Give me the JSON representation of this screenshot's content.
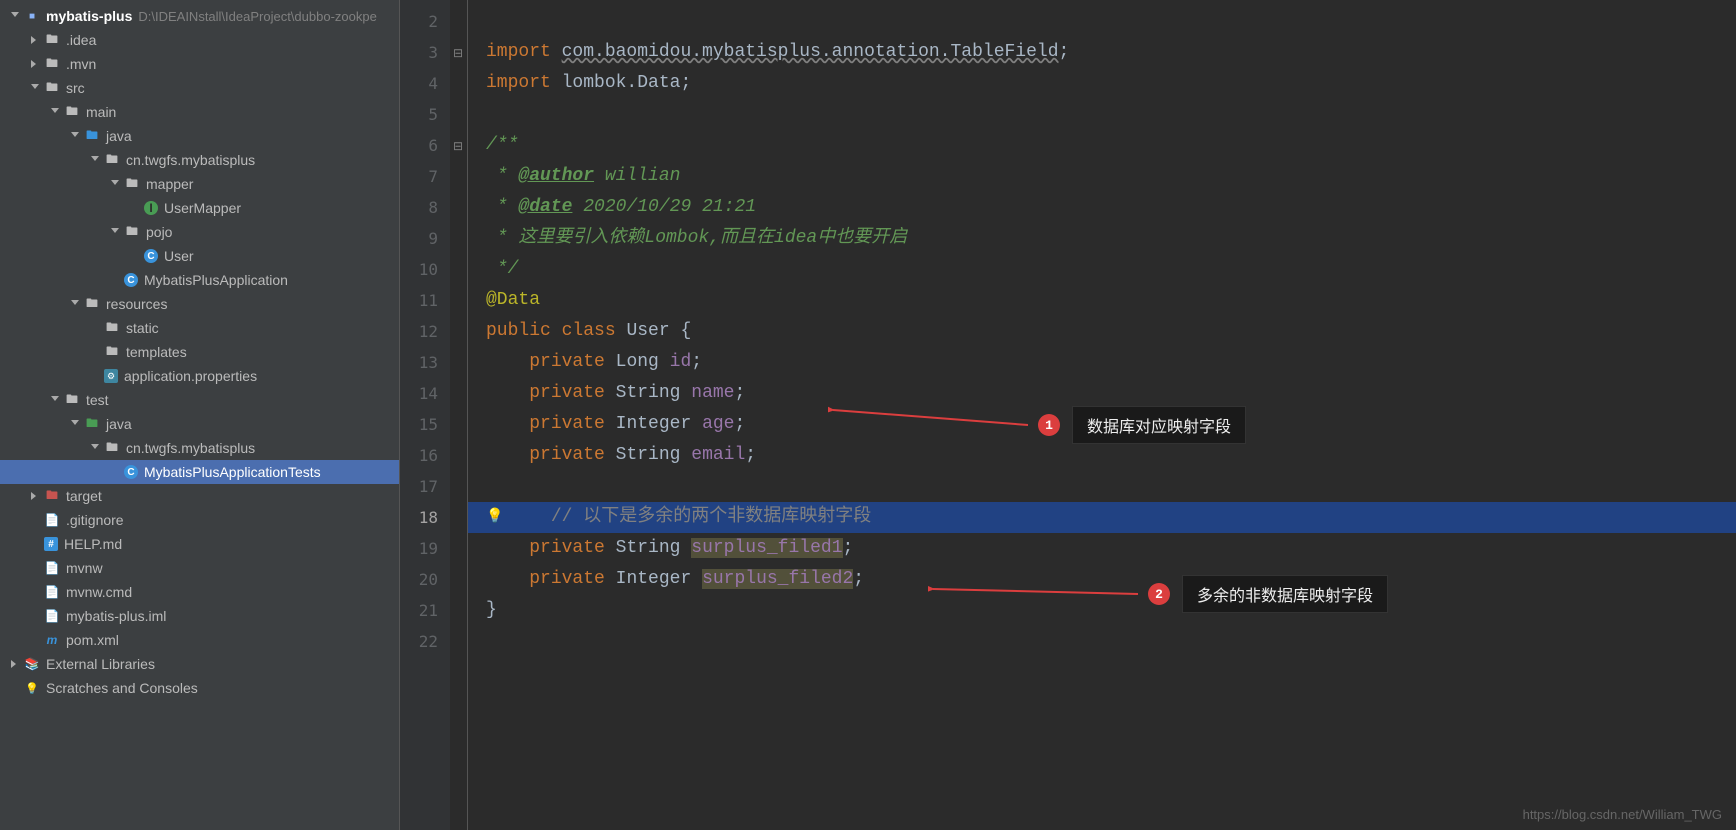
{
  "project": {
    "name": "mybatis-plus",
    "path": "D:\\IDEAINstall\\IdeaProject\\dubbo-zookpe"
  },
  "tree": [
    {
      "depth": 0,
      "chev": "expanded",
      "icon": "module",
      "label": "mybatis-plus",
      "isProject": true
    },
    {
      "depth": 1,
      "chev": "collapsed",
      "icon": "folder",
      "label": ".idea"
    },
    {
      "depth": 1,
      "chev": "collapsed",
      "icon": "folder",
      "label": ".mvn"
    },
    {
      "depth": 1,
      "chev": "expanded",
      "icon": "folder",
      "label": "src"
    },
    {
      "depth": 2,
      "chev": "expanded",
      "icon": "folder",
      "label": "main"
    },
    {
      "depth": 3,
      "chev": "expanded",
      "icon": "folder-src",
      "label": "java"
    },
    {
      "depth": 4,
      "chev": "expanded",
      "icon": "package",
      "label": "cn.twgfs.mybatisplus"
    },
    {
      "depth": 5,
      "chev": "expanded",
      "icon": "package",
      "label": "mapper"
    },
    {
      "depth": 6,
      "chev": "none",
      "icon": "java-int",
      "label": "UserMapper"
    },
    {
      "depth": 5,
      "chev": "expanded",
      "icon": "package",
      "label": "pojo"
    },
    {
      "depth": 6,
      "chev": "none",
      "icon": "java-cls",
      "label": "User"
    },
    {
      "depth": 5,
      "chev": "none",
      "icon": "java-cls",
      "label": "MybatisPlusApplication"
    },
    {
      "depth": 3,
      "chev": "expanded",
      "icon": "folder",
      "label": "resources"
    },
    {
      "depth": 4,
      "chev": "none",
      "icon": "folder",
      "label": "static"
    },
    {
      "depth": 4,
      "chev": "none",
      "icon": "folder",
      "label": "templates"
    },
    {
      "depth": 4,
      "chev": "none",
      "icon": "props",
      "label": "application.properties"
    },
    {
      "depth": 2,
      "chev": "expanded",
      "icon": "folder",
      "label": "test"
    },
    {
      "depth": 3,
      "chev": "expanded",
      "icon": "folder-test",
      "label": "java"
    },
    {
      "depth": 4,
      "chev": "expanded",
      "icon": "package",
      "label": "cn.twgfs.mybatisplus"
    },
    {
      "depth": 5,
      "chev": "none",
      "icon": "java-cls",
      "label": "MybatisPlusApplicationTests",
      "selected": true
    },
    {
      "depth": 1,
      "chev": "collapsed",
      "icon": "folder-target",
      "label": "target"
    },
    {
      "depth": 1,
      "chev": "none",
      "icon": "file",
      "label": ".gitignore"
    },
    {
      "depth": 1,
      "chev": "none",
      "icon": "md",
      "label": "HELP.md"
    },
    {
      "depth": 1,
      "chev": "none",
      "icon": "file",
      "label": "mvnw"
    },
    {
      "depth": 1,
      "chev": "none",
      "icon": "file",
      "label": "mvnw.cmd"
    },
    {
      "depth": 1,
      "chev": "none",
      "icon": "xml",
      "label": "mybatis-plus.iml"
    },
    {
      "depth": 1,
      "chev": "none",
      "icon": "maven",
      "label": "pom.xml"
    },
    {
      "depth": 0,
      "chev": "collapsed",
      "icon": "lib",
      "label": "External Libraries"
    },
    {
      "depth": 0,
      "chev": "none",
      "icon": "scratch",
      "label": "Scratches and Consoles"
    }
  ],
  "editor": {
    "startLine": 2,
    "currentLine": 18,
    "lines": [
      {
        "n": 2,
        "fold": "",
        "tokens": []
      },
      {
        "n": 3,
        "fold": "minus",
        "tokens": [
          {
            "t": "kw",
            "v": "import "
          },
          {
            "t": "import-pkg",
            "v": "com.baomidou.mybatisplus.annotation.TableField"
          },
          {
            "t": "",
            "v": ";"
          }
        ]
      },
      {
        "n": 4,
        "fold": "",
        "tokens": [
          {
            "t": "kw",
            "v": "import "
          },
          {
            "t": "",
            "v": "lombok."
          },
          {
            "t": "",
            "v": "Data"
          },
          {
            "t": "",
            "v": ";"
          }
        ]
      },
      {
        "n": 5,
        "fold": "",
        "tokens": []
      },
      {
        "n": 6,
        "fold": "minus",
        "tokens": [
          {
            "t": "cmt",
            "v": "/**"
          }
        ]
      },
      {
        "n": 7,
        "fold": "",
        "tokens": [
          {
            "t": "cmt",
            "v": " * "
          },
          {
            "t": "cmt-tag",
            "v": "@author"
          },
          {
            "t": "cmt",
            "v": " willian"
          }
        ]
      },
      {
        "n": 8,
        "fold": "",
        "tokens": [
          {
            "t": "cmt",
            "v": " * "
          },
          {
            "t": "cmt-tag",
            "v": "@date"
          },
          {
            "t": "cmt",
            "v": " 2020/10/29 21:21"
          }
        ]
      },
      {
        "n": 9,
        "fold": "",
        "tokens": [
          {
            "t": "cmt",
            "v": " * 这里要引入依赖Lombok,而且在idea中也要开启"
          }
        ]
      },
      {
        "n": 10,
        "fold": "",
        "tokens": [
          {
            "t": "cmt",
            "v": " */"
          }
        ]
      },
      {
        "n": 11,
        "fold": "",
        "tokens": [
          {
            "t": "anno",
            "v": "@Data"
          }
        ]
      },
      {
        "n": 12,
        "fold": "",
        "tokens": [
          {
            "t": "kw",
            "v": "public class "
          },
          {
            "t": "cls",
            "v": "User"
          },
          {
            "t": "",
            "v": " {"
          }
        ]
      },
      {
        "n": 13,
        "fold": "",
        "tokens": [
          {
            "t": "",
            "v": "    "
          },
          {
            "t": "kw",
            "v": "private "
          },
          {
            "t": "typ",
            "v": "Long "
          },
          {
            "t": "fld",
            "v": "id"
          },
          {
            "t": "",
            "v": ";"
          }
        ]
      },
      {
        "n": 14,
        "fold": "",
        "tokens": [
          {
            "t": "",
            "v": "    "
          },
          {
            "t": "kw",
            "v": "private "
          },
          {
            "t": "typ",
            "v": "String "
          },
          {
            "t": "fld",
            "v": "name"
          },
          {
            "t": "",
            "v": ";"
          }
        ]
      },
      {
        "n": 15,
        "fold": "",
        "tokens": [
          {
            "t": "",
            "v": "    "
          },
          {
            "t": "kw",
            "v": "private "
          },
          {
            "t": "typ",
            "v": "Integer "
          },
          {
            "t": "fld",
            "v": "age"
          },
          {
            "t": "",
            "v": ";"
          }
        ]
      },
      {
        "n": 16,
        "fold": "",
        "tokens": [
          {
            "t": "",
            "v": "    "
          },
          {
            "t": "kw",
            "v": "private "
          },
          {
            "t": "typ",
            "v": "String "
          },
          {
            "t": "fld",
            "v": "email"
          },
          {
            "t": "",
            "v": ";"
          }
        ]
      },
      {
        "n": 17,
        "fold": "",
        "tokens": []
      },
      {
        "n": 18,
        "fold": "",
        "hl": true,
        "bulb": true,
        "tokens": [
          {
            "t": "",
            "v": "    "
          },
          {
            "t": "cmt-line underline-grey",
            "v": "// 以下是多余的两个非数据库映射字段"
          }
        ]
      },
      {
        "n": 19,
        "fold": "",
        "tokens": [
          {
            "t": "",
            "v": "    "
          },
          {
            "t": "kw underline-grey",
            "v": "private "
          },
          {
            "t": "typ",
            "v": "String "
          },
          {
            "t": "fld warn-bg",
            "v": "surplus_filed1"
          },
          {
            "t": "",
            "v": ";"
          }
        ]
      },
      {
        "n": 20,
        "fold": "",
        "tokens": [
          {
            "t": "",
            "v": "    "
          },
          {
            "t": "kw",
            "v": "private "
          },
          {
            "t": "typ",
            "v": "Integer "
          },
          {
            "t": "fld warn-bg",
            "v": "surplus_filed2"
          },
          {
            "t": "",
            "v": ";"
          }
        ]
      },
      {
        "n": 21,
        "fold": "",
        "tokens": [
          {
            "t": "",
            "v": "}"
          }
        ]
      },
      {
        "n": 22,
        "fold": "",
        "tokens": []
      }
    ]
  },
  "callouts": [
    {
      "num": "1",
      "text": "数据库对应映射字段"
    },
    {
      "num": "2",
      "text": "多余的非数据库映射字段"
    }
  ],
  "watermark": "https://blog.csdn.net/William_TWG"
}
